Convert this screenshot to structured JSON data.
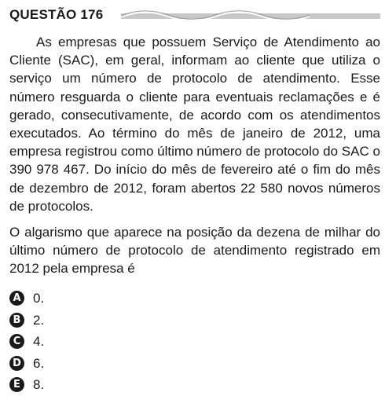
{
  "question": {
    "title": "QUESTÃO 176",
    "paragraph_1": "As empresas que possuem Serviço de Atendimento ao Cliente (SAC), em geral, informam ao cliente que utiliza o serviço um número de protocolo de atendimento. Esse número resguarda o cliente para eventuais reclamações e é gerado, consecutivamente, de acordo com os atendimentos executados. Ao término do mês de janeiro de 2012, uma empresa registrou como último número de protocolo do SAC o 390 978 467. Do início do mês de fevereiro até o fim do mês de dezembro de 2012, foram abertos 22 580 novos números de protocolos.",
    "paragraph_2": "O algarismo que aparece na posição da dezena de milhar do último número de protocolo de atendimento registrado em 2012 pela empresa é",
    "options": [
      {
        "letter": "A",
        "text": "0."
      },
      {
        "letter": "B",
        "text": "2."
      },
      {
        "letter": "C",
        "text": "4."
      },
      {
        "letter": "D",
        "text": "6."
      },
      {
        "letter": "E",
        "text": "8."
      }
    ]
  }
}
